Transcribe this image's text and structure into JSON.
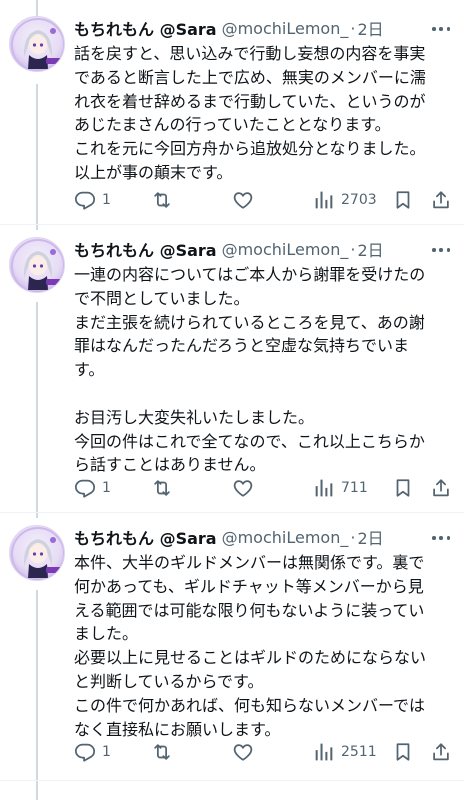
{
  "tweets": [
    {
      "name": "もちれもん @Sara",
      "handle": "@mochiLemon_",
      "separator": "·",
      "time": "2日",
      "lines": [
        "話を戻すと、思い込みで行動し妄想の内容を事実",
        "であると断言した上で広め、無実のメンバーに濡",
        "れ衣を着せ辞めるまで行動していた、というのが",
        "あじたまさんの行っていたこととなります。",
        "これを元に今回方舟から追放処分となりました。",
        "以上が事の顛末です。"
      ],
      "replies": "1",
      "retweets": "",
      "likes": "",
      "views": "2703"
    },
    {
      "name": "もちれもん @Sara",
      "handle": "@mochiLemon_",
      "separator": "·",
      "time": "2日",
      "lines": [
        "一連の内容についてはご本人から謝罪を受けたの",
        "で不問としていました。",
        "まだ主張を続けられているところを見て、あの謝",
        "罪はなんだったんだろうと空虚な気持ちでいま",
        "す。",
        "",
        "お目汚し大変失礼いたしました。",
        "今回の件はこれで全てなので、これ以上こちらか",
        "ら話すことはありません。"
      ],
      "replies": "1",
      "retweets": "",
      "likes": "",
      "views": "711"
    },
    {
      "name": "もちれもん @Sara",
      "handle": "@mochiLemon_",
      "separator": "·",
      "time": "2日",
      "lines": [
        "本件、大半のギルドメンバーは無関係です。裏で",
        "何かあっても、ギルドチャット等メンバーから見",
        "える範囲では可能な限り何もないように装ってい",
        "ました。",
        "必要以上に見せることはギルドのためにならない",
        "と判断しているからです。",
        "この件で何かあれば、何も知らないメンバーでは",
        "なく直接私にお願いします。"
      ],
      "replies": "1",
      "retweets": "",
      "likes": "",
      "views": "2511"
    }
  ],
  "icons": {
    "reply": "reply-icon",
    "retweet": "retweet-icon",
    "like": "like-icon",
    "views": "views-icon",
    "bookmark": "bookmark-icon",
    "share": "share-icon",
    "more": "more-icon"
  },
  "colors": {
    "text": "#0f1419",
    "secondary": "#536471",
    "thread_line": "#cfd9de",
    "divider": "#eff3f4",
    "avatar_accent": "#7a3bb5"
  }
}
